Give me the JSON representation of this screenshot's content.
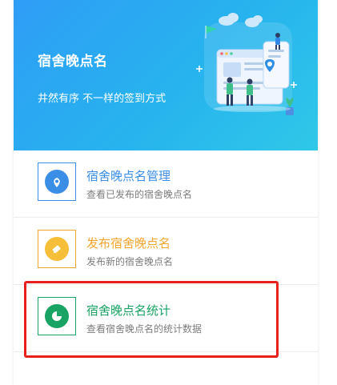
{
  "banner": {
    "title": "宿舍晚点名",
    "subtitle": "井然有序 不一样的签到方式",
    "gradient_start": "#2f9df6",
    "gradient_end": "#2fc8e8",
    "illustration_icon": "people-checkin-illustration"
  },
  "items": [
    {
      "title": "宿舍晚点名管理",
      "desc": "查看已发布的宿舍晚点名",
      "color": "#3a8ee6",
      "icon": "map-pin-icon"
    },
    {
      "title": "发布宿舍晚点名",
      "desc": "发布新的宿舍晚点名",
      "color": "#f2a52d",
      "icon": "pencil-icon"
    },
    {
      "title": "宿舍晚点名统计",
      "desc": "查看宿舍晚点名的统计数据",
      "color": "#19a364",
      "icon": "pie-chart-icon"
    }
  ],
  "highlight": {
    "color": "#e8201c",
    "target": "宿舍晚点名统计"
  }
}
